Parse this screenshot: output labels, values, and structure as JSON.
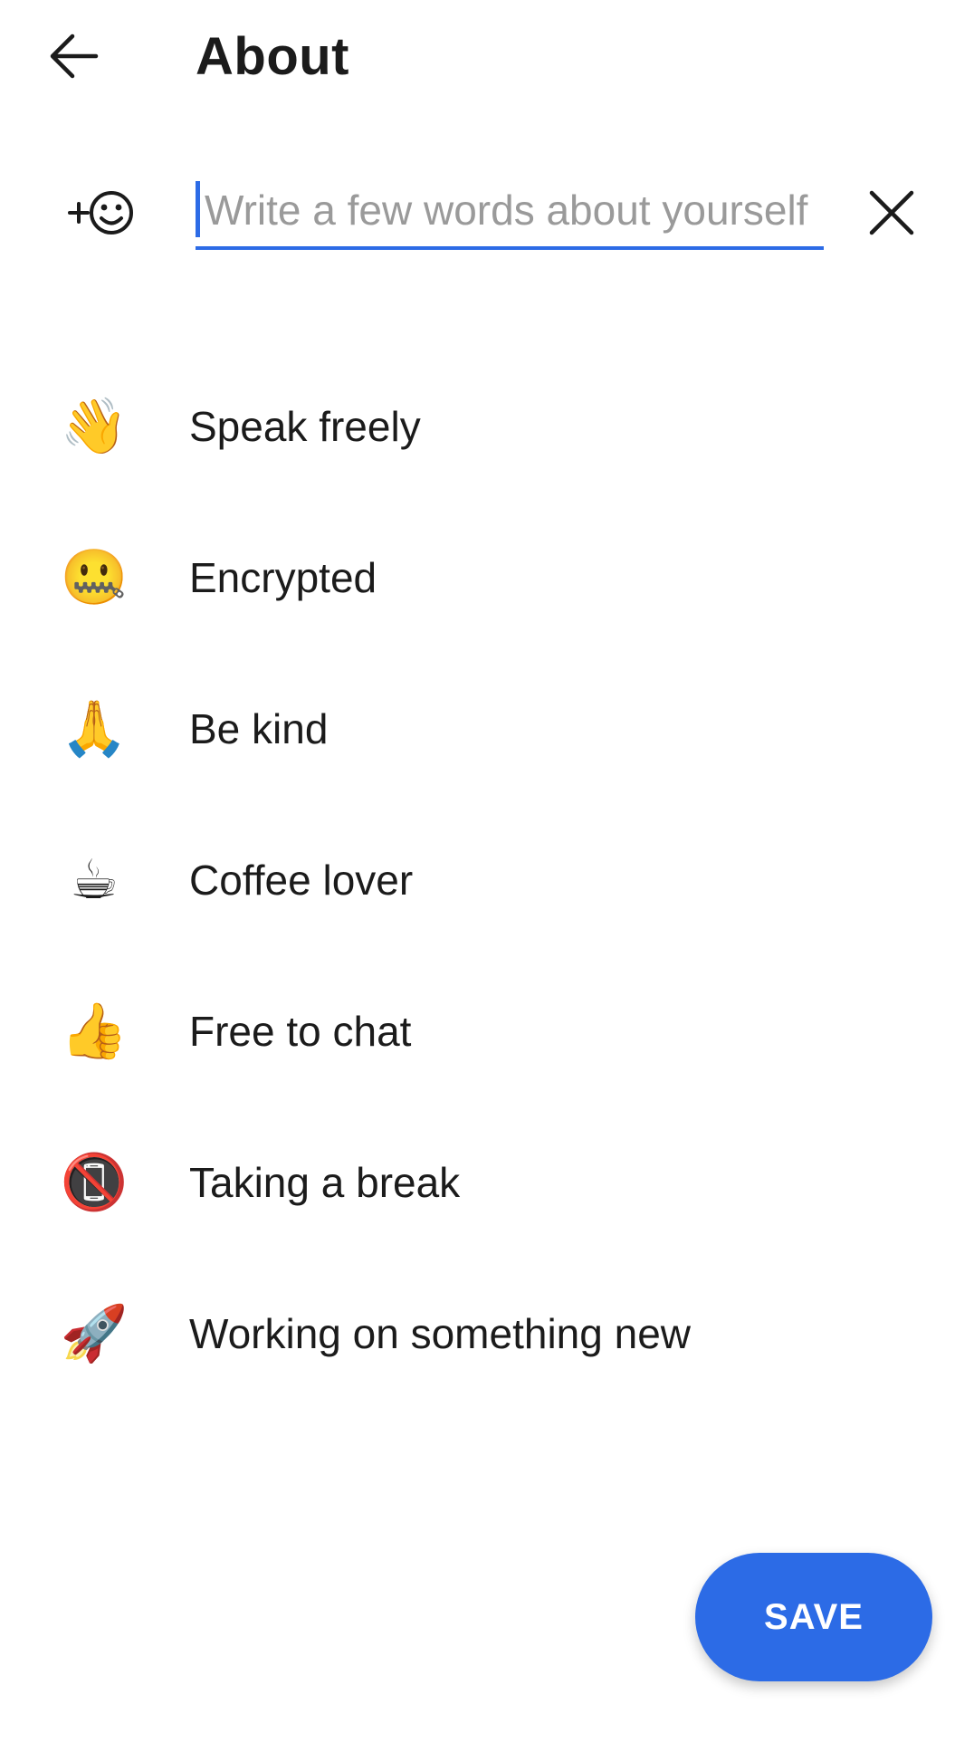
{
  "header": {
    "title": "About",
    "back_icon": "arrow-left-icon"
  },
  "about_input": {
    "value": "",
    "placeholder": "Write a few words about yourself",
    "emoji_icon": "add-emoji-icon",
    "clear_icon": "close-icon",
    "accent_color": "#2c6be6"
  },
  "suggestions": [
    {
      "emoji": "👋",
      "icon": "waving-hand-icon",
      "label": "Speak freely"
    },
    {
      "emoji": "🤐",
      "icon": "zipper-mouth-face-icon",
      "label": "Encrypted"
    },
    {
      "emoji": "🙏",
      "icon": "folded-hands-icon",
      "label": "Be kind"
    },
    {
      "emoji": "☕",
      "icon": "hot-beverage-icon",
      "label": "Coffee lover"
    },
    {
      "emoji": "👍",
      "icon": "thumbs-up-icon",
      "label": "Free to chat"
    },
    {
      "emoji": "📵",
      "icon": "no-mobile-phones-icon",
      "label": "Taking a break"
    },
    {
      "emoji": "🚀",
      "icon": "rocket-icon",
      "label": "Working on something new"
    }
  ],
  "save_button": {
    "label": "SAVE",
    "color": "#2c6be6"
  }
}
